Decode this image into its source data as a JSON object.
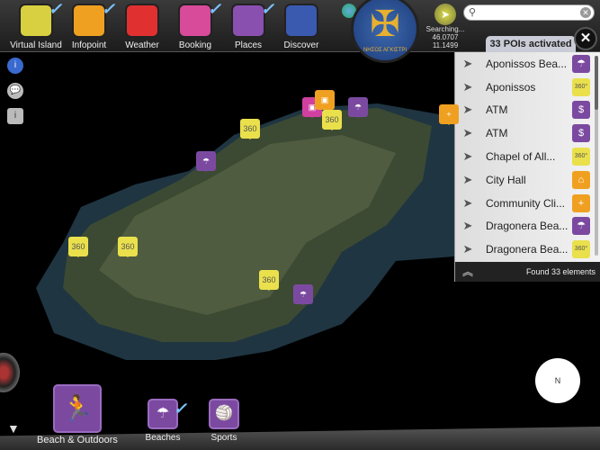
{
  "apps": [
    {
      "label": "Virtual Island",
      "color": "#d8d040",
      "checked": true,
      "icon": "globe-icon"
    },
    {
      "label": "Infopoint",
      "color": "#f0a020",
      "checked": true,
      "icon": "info-icon"
    },
    {
      "label": "Weather",
      "color": "#e03030",
      "checked": false,
      "icon": "cloud-icon"
    },
    {
      "label": "Booking",
      "color": "#d84a9a",
      "checked": true,
      "icon": "bag-icon"
    },
    {
      "label": "Places",
      "color": "#8a50b0",
      "checked": true,
      "icon": "pin-icon"
    },
    {
      "label": "Discover",
      "color": "#3a5ab0",
      "checked": false,
      "icon": "discover-icon"
    }
  ],
  "emblem_text": "ΝΗΣΟΣ ΑΓΚΙΣΤΡΙ",
  "gps": {
    "status": "Searching...",
    "lat": "46.0707",
    "lon": "11.1499"
  },
  "search": {
    "placeholder": ""
  },
  "panel": {
    "title": "33 POIs activated",
    "footer": "Found 33 elements",
    "items": [
      {
        "name": "Aponissos Bea...",
        "type": "p",
        "glyph": "☂"
      },
      {
        "name": "Aponissos",
        "type": "y",
        "glyph": "360°"
      },
      {
        "name": "ATM",
        "type": "p",
        "glyph": "$"
      },
      {
        "name": "ATM",
        "type": "p",
        "glyph": "$"
      },
      {
        "name": "Chapel of All...",
        "type": "y",
        "glyph": "360°"
      },
      {
        "name": "City Hall",
        "type": "o",
        "glyph": "⌂"
      },
      {
        "name": "Community Cli...",
        "type": "o",
        "glyph": "+"
      },
      {
        "name": "Dragonera Bea...",
        "type": "p",
        "glyph": "☂"
      },
      {
        "name": "Dragonera Bea...",
        "type": "y",
        "glyph": "360°"
      }
    ]
  },
  "bottom": {
    "main_category": "Beach & Outdoors",
    "subs": [
      {
        "label": "Beaches",
        "checked": true
      },
      {
        "label": "Sports",
        "checked": false
      }
    ]
  },
  "compass_label": "N"
}
